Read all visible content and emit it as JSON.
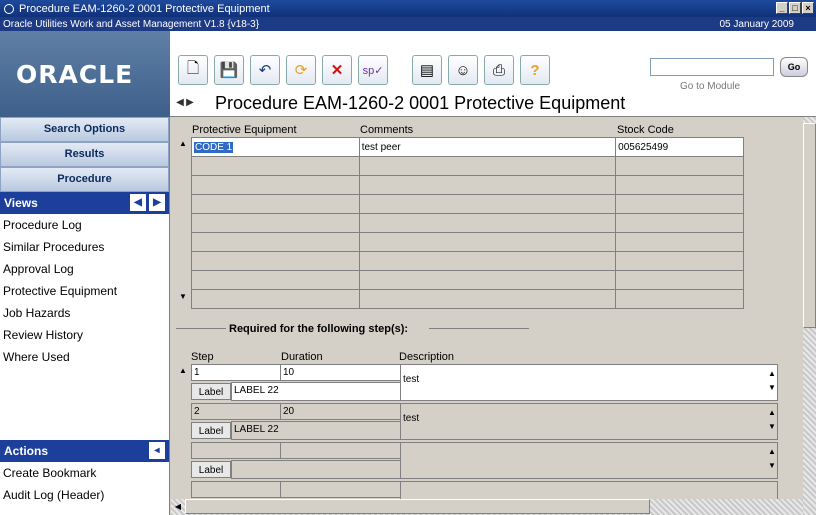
{
  "window": {
    "title": "Procedure EAM-1260-2 0001 Protective Equipment",
    "subtitle": "Oracle Utilities Work and Asset Management V1.8 {v18-3}",
    "date": "05 January  2009",
    "controls": [
      "minimize-icon",
      "maximize-icon",
      "close-icon"
    ]
  },
  "header": {
    "logo": "ORACLE",
    "toolbar": [
      "new-document-icon",
      "save-icon",
      "undo-icon",
      "refresh-icon",
      "delete-icon",
      "spell-check-icon",
      "report-icon",
      "user-icon",
      "print-icon",
      "help-icon"
    ],
    "goto_placeholder": "",
    "go_label": "Go",
    "goto_label": "Go to Module",
    "page_title": "Procedure EAM-1260-2 0001 Protective Equipment"
  },
  "sidebar": {
    "buttons": [
      "Search Options",
      "Results",
      "Procedure"
    ],
    "views_label": "Views",
    "views": [
      "Procedure Log",
      "Similar Procedures",
      "Approval Log",
      "Protective Equipment",
      "Job Hazards",
      "Review History",
      "Where Used"
    ],
    "actions_label": "Actions",
    "actions": [
      "Create Bookmark",
      "Audit Log (Header)"
    ]
  },
  "equipment_grid": {
    "columns": [
      "Protective Equipment",
      "Comments",
      "Stock Code"
    ],
    "rows": [
      [
        "CODE 1",
        "test peer",
        "005625499"
      ],
      [
        "",
        "",
        ""
      ],
      [
        "",
        "",
        ""
      ],
      [
        "",
        "",
        ""
      ],
      [
        "",
        "",
        ""
      ],
      [
        "",
        "",
        ""
      ],
      [
        "",
        "",
        ""
      ],
      [
        "",
        "",
        ""
      ],
      [
        "",
        "",
        ""
      ]
    ]
  },
  "steps": {
    "section_label": "Required for the following step(s):",
    "columns": [
      "Step",
      "Duration",
      "Description"
    ],
    "label_button": "Label",
    "rows": [
      {
        "step": "1",
        "duration": "10",
        "description": "test",
        "label": "LABEL 22"
      },
      {
        "step": "2",
        "duration": "20",
        "description": "test",
        "label": "LABEL 22"
      },
      {
        "step": "",
        "duration": "",
        "description": "",
        "label": ""
      }
    ]
  }
}
